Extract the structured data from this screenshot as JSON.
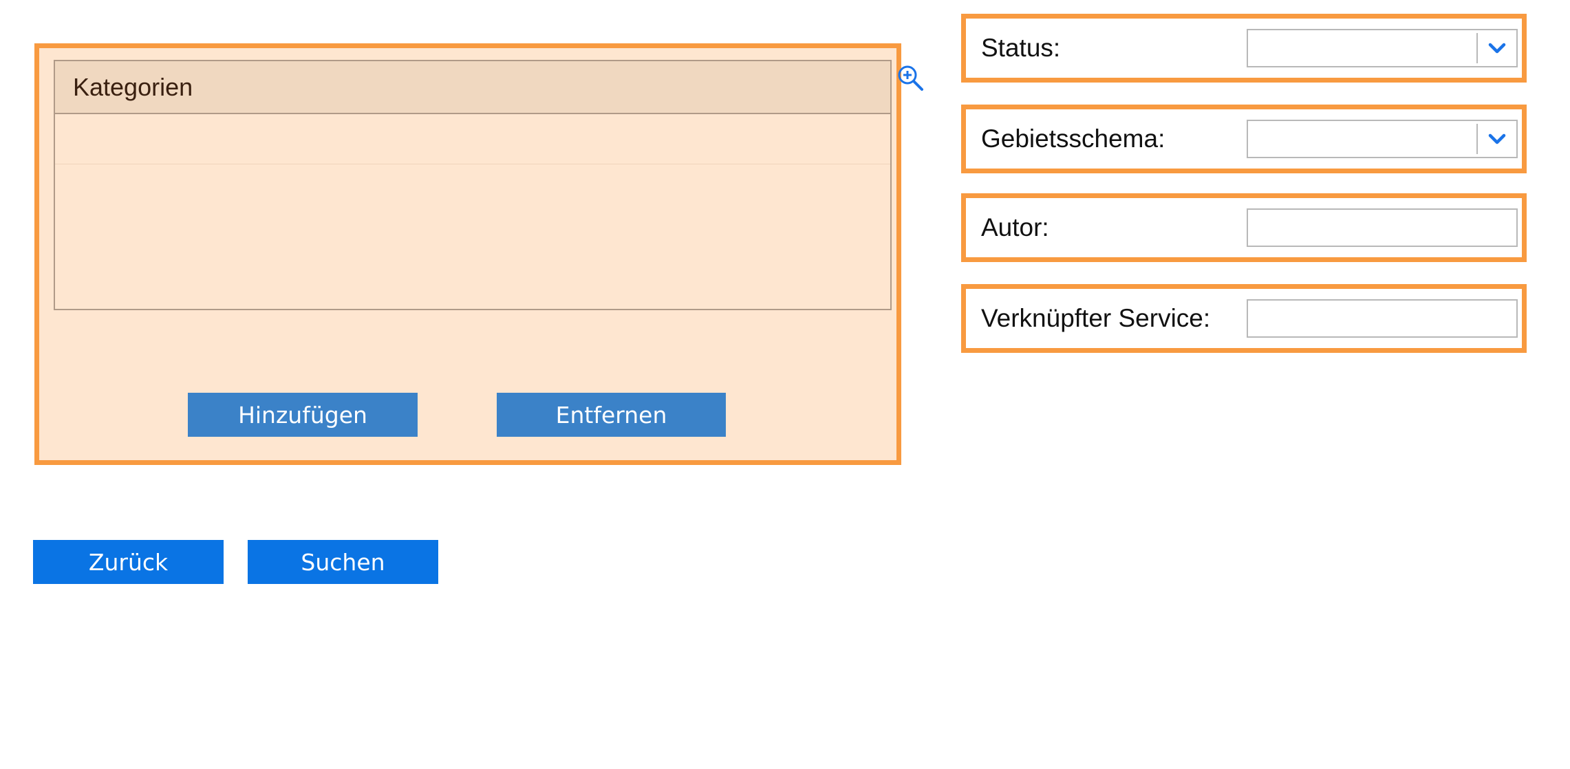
{
  "categories_panel": {
    "header": "Kategorien",
    "rows": [
      "",
      ""
    ],
    "add_label": "Hinzufügen",
    "remove_label": "Entfernen",
    "zoom_icon": "zoom-in-icon"
  },
  "fields": {
    "status": {
      "label": "Status:",
      "value": ""
    },
    "area_scheme": {
      "label": "Gebietsschema:",
      "value": ""
    },
    "author": {
      "label": "Autor:",
      "value": ""
    },
    "linked_service": {
      "label": "Verknüpfter Service:",
      "value": ""
    }
  },
  "actions": {
    "back_label": "Zurück",
    "search_label": "Suchen"
  },
  "colors": {
    "highlight_border": "#f89a40",
    "panel_background": "#fee6d0",
    "panel_button": "#3b82c8",
    "primary_button": "#0a74e4",
    "chevron": "#1a73e8"
  }
}
